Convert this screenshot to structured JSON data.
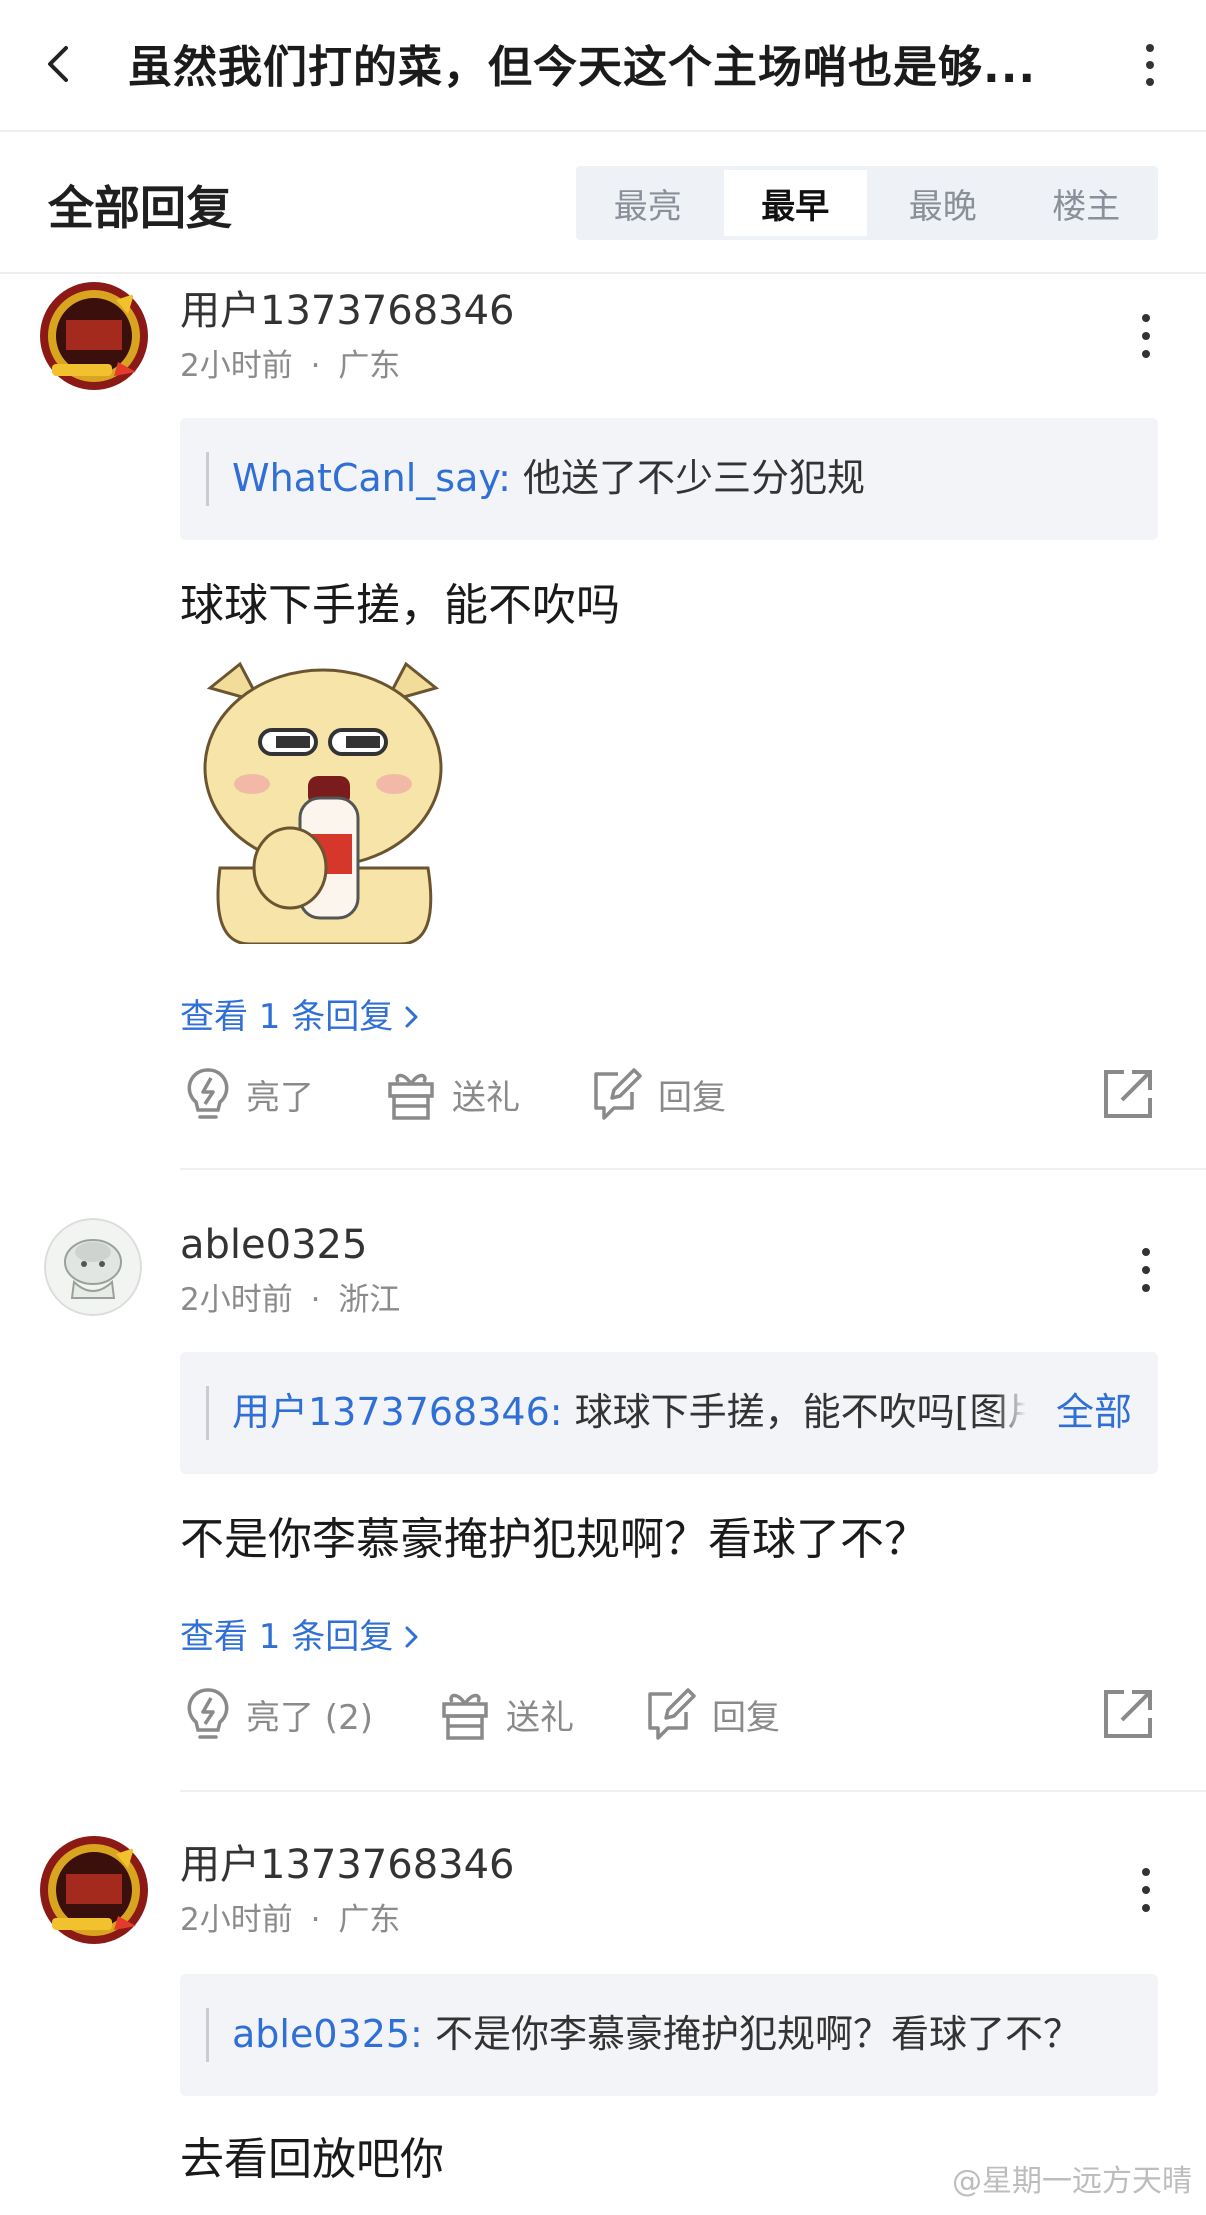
{
  "header": {
    "title": "虽然我们打的菜，但今天这个主场哨也是够..."
  },
  "replies_section": {
    "title": "全部回复",
    "sort_tabs": [
      "最亮",
      "最早",
      "最晚",
      "楼主"
    ],
    "active_tab": "最早"
  },
  "comments": [
    {
      "username": "用户1373768346",
      "time": "2小时前",
      "location": "广东",
      "quote_user": "WhatCanl_say:",
      "quote_text": " 他送了不少三分犯规",
      "body": "球球下手搓，能不吹吗",
      "view_replies": "查看 1 条回复",
      "like_label": "亮了",
      "gift_label": "送礼",
      "reply_label": "回复"
    },
    {
      "username": "able0325",
      "time": "2小时前",
      "location": "浙江",
      "quote_user": "用户1373768346:",
      "quote_text": " 球球下手搓，能不吹吗[图片]",
      "quote_more": "全部",
      "body": "不是你李慕豪掩护犯规啊？看球了不？",
      "view_replies": "查看 1 条回复",
      "like_label": "亮了 (2)",
      "gift_label": "送礼",
      "reply_label": "回复"
    },
    {
      "username": "用户1373768346",
      "time": "2小时前",
      "location": "广东",
      "quote_user": "able0325:",
      "quote_text": " 不是你李慕豪掩护犯规啊？看球了不？",
      "body": "去看回放吧你"
    }
  ],
  "separator": "·",
  "watermark": "@星期一远方天晴",
  "colors": {
    "link_blue": "#2f6fd6",
    "quote_bg": "#f3f4f7",
    "tab_bg": "#eef1f6"
  }
}
